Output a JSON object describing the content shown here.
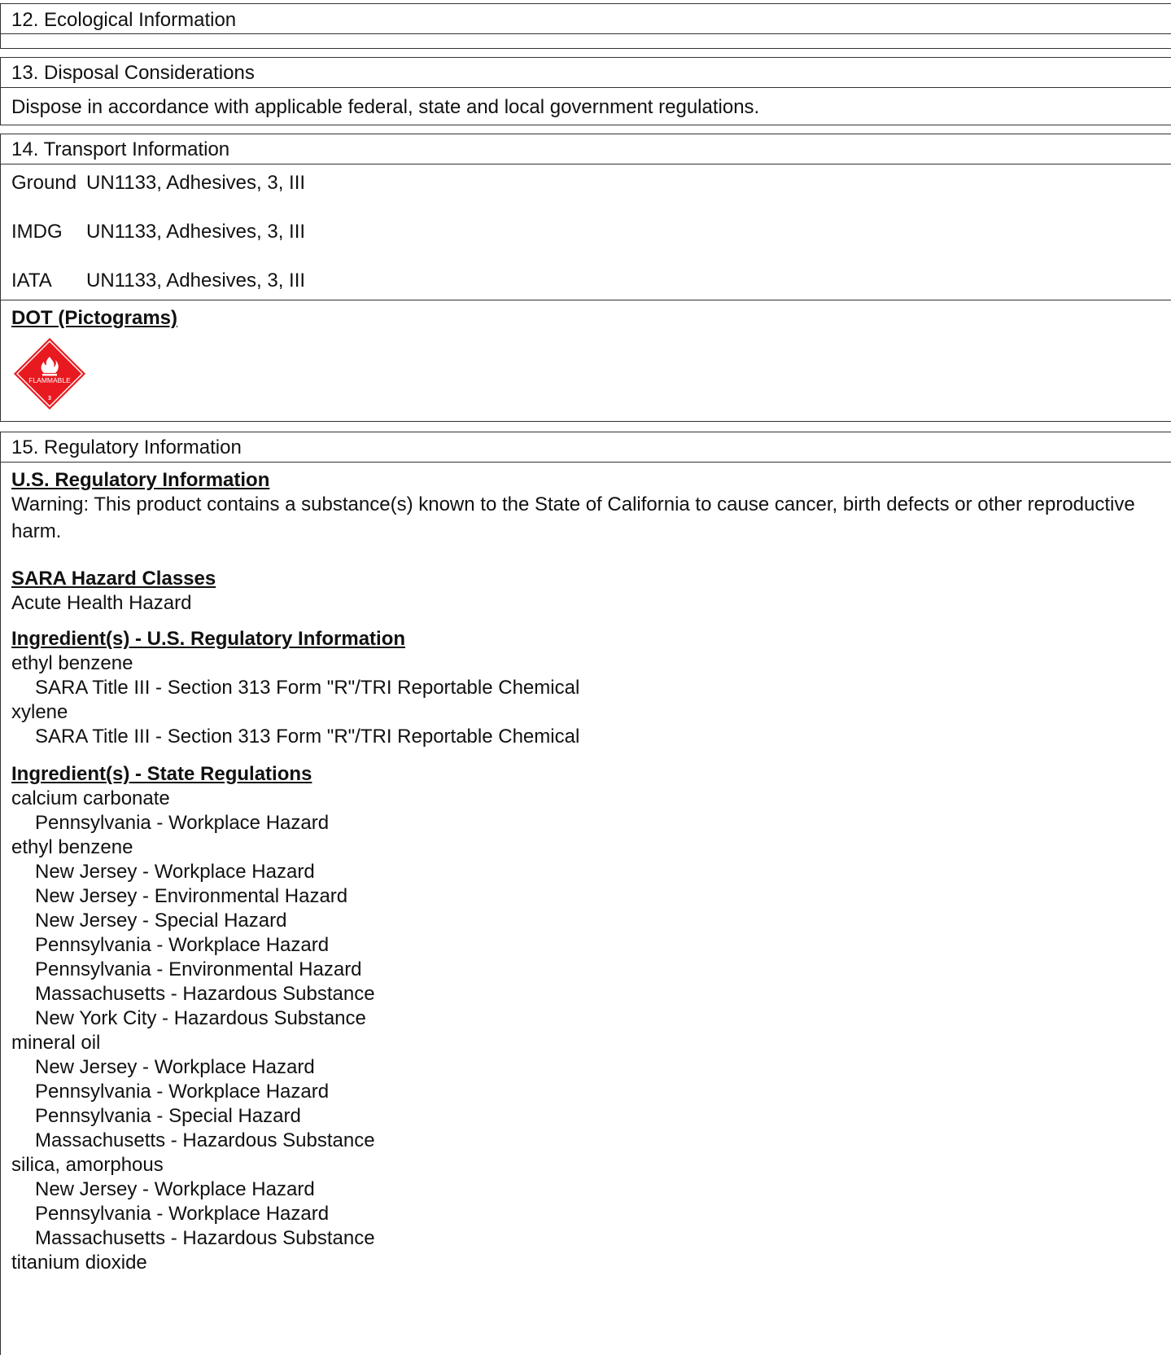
{
  "s12": {
    "heading": "12. Ecological Information"
  },
  "s13": {
    "heading": "13. Disposal Considerations",
    "text": "Dispose in accordance with applicable federal, state and local government regulations."
  },
  "s14": {
    "heading": "14. Transport Information",
    "rows": [
      {
        "mode": "Ground",
        "value": "UN1133, Adhesives, 3, III"
      },
      {
        "mode": "IMDG",
        "value": "UN1133, Adhesives, 3, III"
      },
      {
        "mode": "IATA",
        "value": "UN1133, Adhesives, 3, III"
      }
    ],
    "dot_heading": "DOT (Pictograms)",
    "pictogram": {
      "icon": "flammable-diamond-icon",
      "label": "FLAMMABLE",
      "class_number": "3",
      "color": "#e8191f"
    }
  },
  "s15": {
    "heading": "15. Regulatory Information",
    "us_heading": "U.S. Regulatory Information",
    "warning": "Warning:  This product contains a substance(s) known to the State of California to cause cancer, birth defects or other reproductive harm.",
    "sara_heading": "SARA Hazard Classes",
    "sara_text": "Acute Health Hazard",
    "ing_us_heading": "Ingredient(s) - U.S. Regulatory Information",
    "ing_us": [
      {
        "name": "ethyl benzene",
        "items": [
          "SARA Title III - Section 313 Form \"R\"/TRI Reportable Chemical"
        ]
      },
      {
        "name": "xylene",
        "items": [
          "SARA Title III - Section 313 Form \"R\"/TRI Reportable Chemical"
        ]
      }
    ],
    "ing_state_heading": "Ingredient(s) - State Regulations",
    "ing_state": [
      {
        "name": "calcium carbonate",
        "items": [
          "Pennsylvania - Workplace Hazard"
        ]
      },
      {
        "name": "ethyl benzene",
        "items": [
          "New Jersey - Workplace Hazard",
          "New Jersey - Environmental Hazard",
          "New Jersey - Special Hazard",
          "Pennsylvania - Workplace Hazard",
          "Pennsylvania - Environmental Hazard",
          "Massachusetts - Hazardous Substance",
          "New York City - Hazardous Substance"
        ]
      },
      {
        "name": "mineral oil",
        "items": [
          "New Jersey - Workplace Hazard",
          "Pennsylvania - Workplace Hazard",
          "Pennsylvania - Special Hazard",
          "Massachusetts - Hazardous Substance"
        ]
      },
      {
        "name": "silica, amorphous",
        "items": [
          "New Jersey - Workplace Hazard",
          "Pennsylvania - Workplace Hazard",
          "Massachusetts - Hazardous Substance"
        ]
      },
      {
        "name": "titanium dioxide",
        "items": []
      }
    ]
  }
}
